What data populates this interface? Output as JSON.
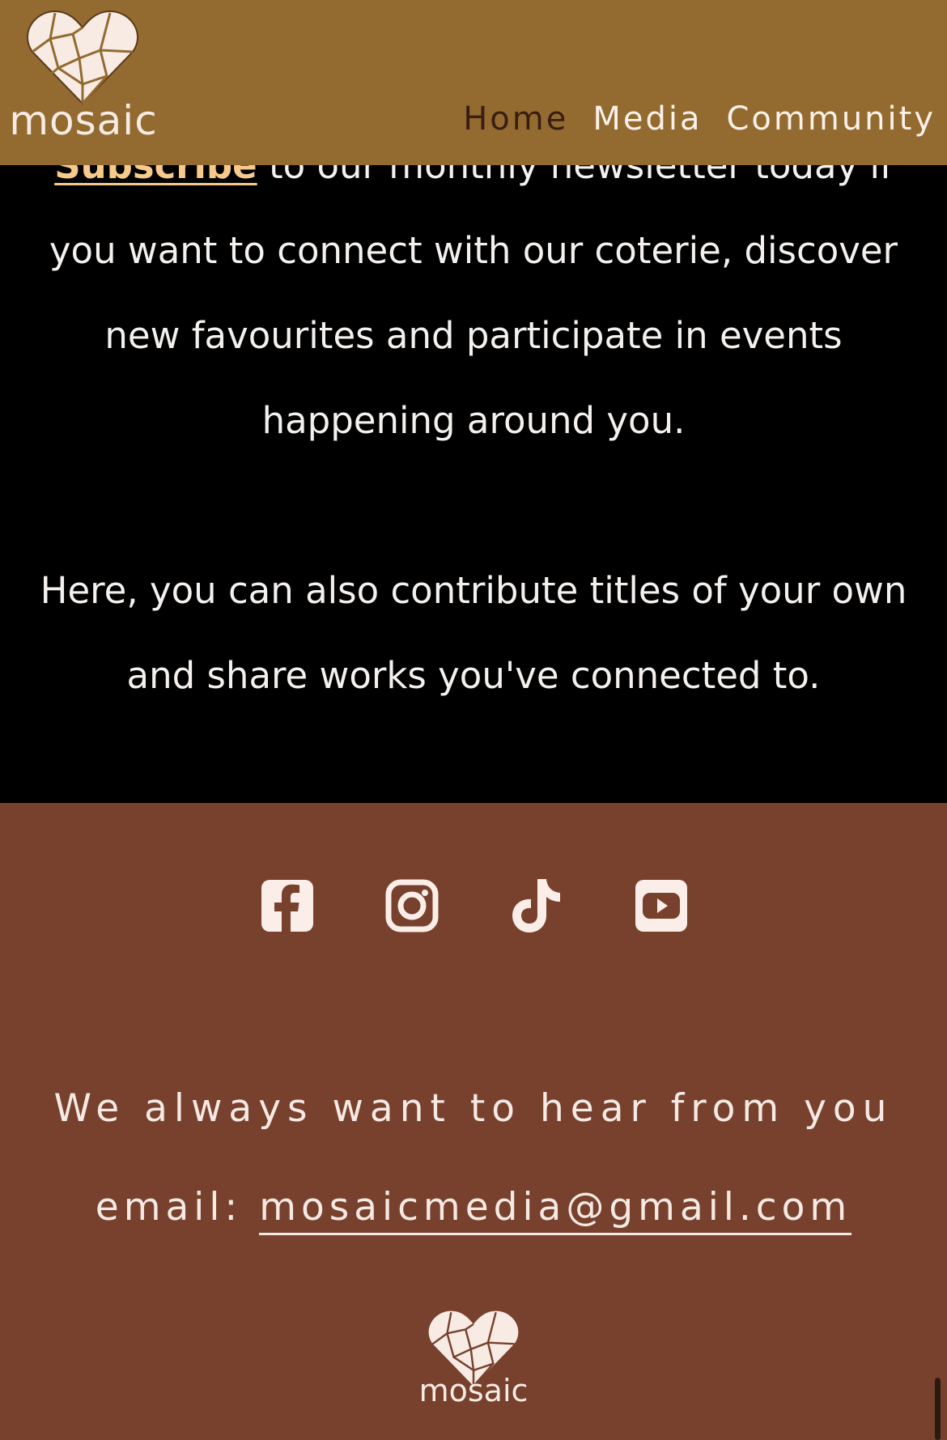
{
  "header": {
    "logo_text": "mosaic",
    "nav": [
      {
        "label": "Home"
      },
      {
        "label": "Media"
      },
      {
        "label": "Community"
      }
    ]
  },
  "intro": {
    "subscribe_link": "Subscribe",
    "paragraph1_rest": " to our monthly newsletter today if you want to connect with our coterie, discover new favourites and participate in events happening around you.",
    "paragraph2": "Here, you can also contribute titles of your own and share works you've connected to."
  },
  "footer": {
    "social_icons": [
      "facebook-icon",
      "instagram-icon",
      "tiktok-icon",
      "youtube-icon"
    ],
    "contact_heading": "We always want to hear from you",
    "email_label": "email: ",
    "email_address": "mosaicmedia@gmail.com",
    "logo_text": "mosaic"
  },
  "colors": {
    "header_bg": "#936b30",
    "footer_bg": "#77412d",
    "accent_link": "#f7c98b",
    "text_light": "#f3f0ee"
  }
}
